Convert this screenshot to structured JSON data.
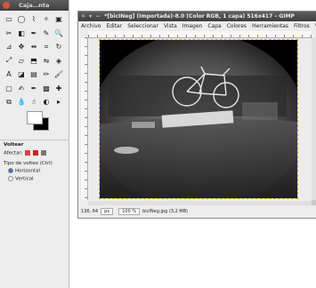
{
  "toolbox": {
    "title": "Caja…nta",
    "tools": [
      [
        "rect-select-icon",
        "ellipse-select-icon",
        "free-select-icon",
        "fuzzy-select-icon",
        "color-select-icon"
      ],
      [
        "scissors-icon",
        "foreground-select-icon",
        "paths-icon",
        "color-picker-icon",
        "zoom-icon"
      ],
      [
        "measure-icon",
        "move-icon",
        "align-icon",
        "crop-icon",
        "rotate-icon"
      ],
      [
        "scale-icon",
        "shear-icon",
        "perspective-icon",
        "flip-icon",
        "cage-icon"
      ],
      [
        "text-icon",
        "bucket-fill-icon",
        "blend-icon",
        "pencil-icon",
        "paintbrush-icon"
      ],
      [
        "eraser-icon",
        "airbrush-icon",
        "ink-icon",
        "clone-icon",
        "heal-icon"
      ],
      [
        "perspective-clone-icon",
        "blur-icon",
        "smudge-icon",
        "dodge-burn-icon",
        "extra-icon"
      ]
    ],
    "glyphs": [
      [
        "▭",
        "◯",
        "⌇",
        "✧",
        "▣"
      ],
      [
        "✂",
        "◧",
        "✒",
        "✎",
        "🔍"
      ],
      [
        "⊿",
        "✥",
        "⇹",
        "⌗",
        "↻"
      ],
      [
        "⤢",
        "▱",
        "⬒",
        "⇋",
        "◈"
      ],
      [
        "A",
        "◪",
        "▤",
        "✏",
        "🖌"
      ],
      [
        "▢",
        "✍",
        "✒",
        "▩",
        "✚"
      ],
      [
        "⧉",
        "💧",
        "☝",
        "◐",
        "▸"
      ]
    ],
    "options": {
      "heading": "Voltear",
      "affect_label": "Afectar:",
      "flip_type_label": "Tipo de volteo  (Ctrl)",
      "horizontal": "Horizontal",
      "vertical": "Vertical"
    }
  },
  "image_window": {
    "title": "*[bicINeg] (Importada)-8.0 (Color RGB, 1 capa) 516x417 – GIMP",
    "window_controls": "✕ ▾ −",
    "menu": [
      "Archivo",
      "Editar",
      "Seleccionar",
      "Vista",
      "Imagen",
      "Capa",
      "Colores",
      "Herramientas",
      "Filtros",
      "Ve"
    ],
    "status": {
      "coords": "136, 64",
      "unit": "px",
      "zoom": "100 %",
      "file_info": "bicINeg.jpg (3,2 MB)"
    }
  }
}
